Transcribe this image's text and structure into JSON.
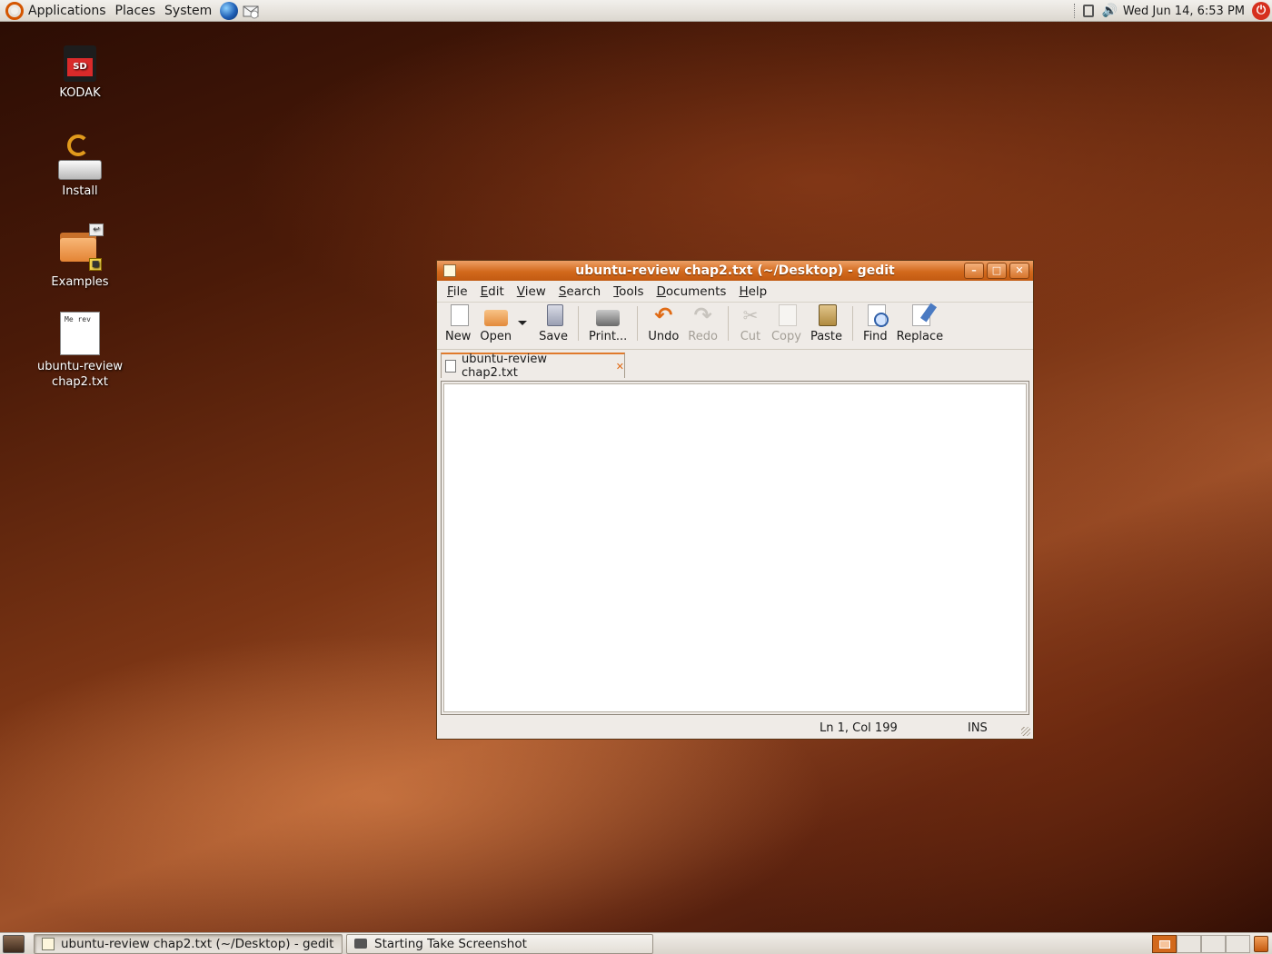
{
  "top_panel": {
    "menus": [
      "Applications",
      "Places",
      "System"
    ],
    "clock": "Wed Jun 14,  6:53 PM"
  },
  "desktop": {
    "icons": [
      {
        "label": "KODAK",
        "badge_text": "SD"
      },
      {
        "label": "Install"
      },
      {
        "label": "Examples"
      },
      {
        "label": "ubuntu-review chap2.txt",
        "preview_text": "Me rev"
      }
    ]
  },
  "window": {
    "title": "ubuntu-review chap2.txt (~/Desktop) - gedit",
    "menubar": [
      {
        "label": "File",
        "mnemonic": "F",
        "rest": "ile"
      },
      {
        "label": "Edit",
        "mnemonic": "E",
        "rest": "dit"
      },
      {
        "label": "View",
        "mnemonic": "V",
        "rest": "iew"
      },
      {
        "label": "Search",
        "mnemonic": "S",
        "rest": "earch"
      },
      {
        "label": "Tools",
        "mnemonic": "T",
        "rest": "ools"
      },
      {
        "label": "Documents",
        "mnemonic": "D",
        "rest": "ocuments"
      },
      {
        "label": "Help",
        "mnemonic": "H",
        "rest": "elp"
      }
    ],
    "toolbar": {
      "new": "New",
      "open": "Open",
      "save": "Save",
      "print": "Print...",
      "undo": "Undo",
      "redo": "Redo",
      "cut": "Cut",
      "copy": "Copy",
      "paste": "Paste",
      "find": "Find",
      "replace": "Replace"
    },
    "tab": {
      "label": "ubuntu-review chap2.txt"
    },
    "editor": {
      "content": ""
    },
    "status": {
      "position": "Ln 1, Col 199",
      "mode": "INS"
    }
  },
  "bottom_panel": {
    "tasks": [
      {
        "label": "ubuntu-review chap2.txt (~/Desktop) - gedit",
        "active": true
      },
      {
        "label": "Starting Take Screenshot",
        "active": false
      }
    ],
    "workspaces": 4
  },
  "colors": {
    "accent": "#d2691c",
    "title_text": "#ffffff"
  }
}
